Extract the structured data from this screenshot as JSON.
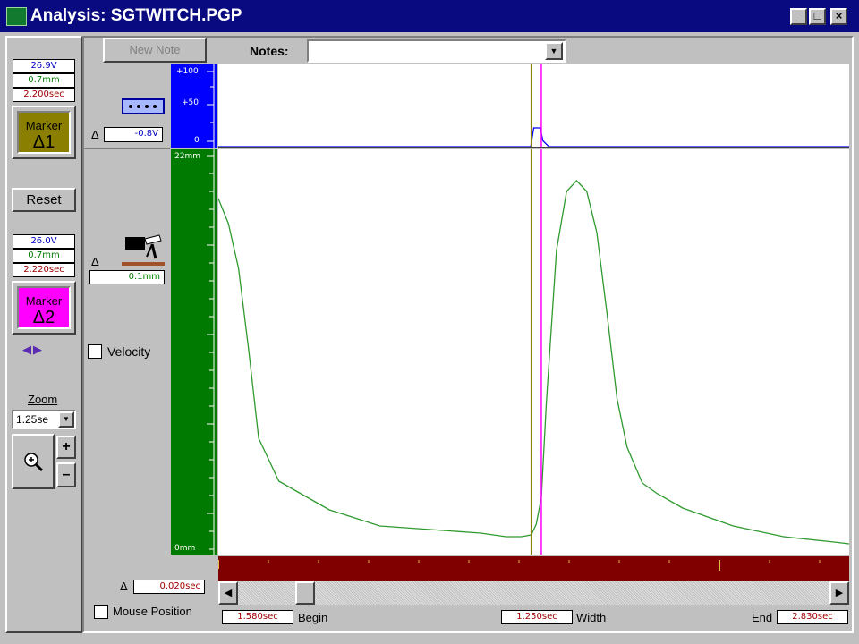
{
  "window": {
    "title": "Analysis: SGTWITCH.PGP",
    "buttons": {
      "minimize": "_",
      "maximize": "□",
      "close": "×"
    }
  },
  "marker1": {
    "voltage": "26.9V",
    "distance": "0.7mm",
    "time": "2.200sec",
    "label": "Marker",
    "symbol": "Δ1",
    "color": "#8a7f00"
  },
  "reset_label": "Reset",
  "marker2": {
    "voltage": "26.0V",
    "distance": "0.7mm",
    "time": "2.220sec",
    "label": "Marker",
    "symbol": "Δ2",
    "color": "#ff00ff"
  },
  "arrows": {
    "left": "◀",
    "right": "▶"
  },
  "zoom": {
    "label": "Zoom",
    "value": "1.25se",
    "plus": "+",
    "minus": "–"
  },
  "toolbar": {
    "new_note": "New Note",
    "notes_label": "Notes:",
    "notes_value": ""
  },
  "stimulus": {
    "delta_symbol": "Δ",
    "delta_value": "-0.8V",
    "scale": {
      "top": "+100",
      "mid": "+50",
      "bottom": "0"
    },
    "color": "#0000ff"
  },
  "force": {
    "delta_symbol": "Δ",
    "delta_value": "0.1mm",
    "scale": {
      "top": "22mm",
      "bottom": "0mm"
    },
    "color": "#007a00",
    "velocity_label": "Velocity"
  },
  "bottom": {
    "delta_symbol": "Δ",
    "delta_value": "0.020sec",
    "mouse_position_label": "Mouse Position",
    "begin_value": "1.580sec",
    "begin_label": "Begin",
    "width_value": "1.250sec",
    "width_label": "Width",
    "end_label": "End",
    "end_value": "2.830sec"
  },
  "chart_data": {
    "type": "line",
    "x_range": [
      1.58,
      2.83
    ],
    "marker_times": [
      2.2,
      2.22
    ],
    "series": [
      {
        "color": "#2f9a2f",
        "ylim": [
          0,
          22
        ],
        "x": [
          1.58,
          1.6,
          1.62,
          1.64,
          1.66,
          1.7,
          1.75,
          1.8,
          1.9,
          2.0,
          2.1,
          2.15,
          2.18,
          2.2,
          2.21,
          2.22,
          2.23,
          2.25,
          2.27,
          2.29,
          2.31,
          2.33,
          2.35,
          2.37,
          2.39,
          2.42,
          2.45,
          2.5,
          2.6,
          2.7,
          2.8,
          2.83
        ],
        "y": [
          19.4,
          18.0,
          15.5,
          11.0,
          6.0,
          3.6,
          2.8,
          2.0,
          1.1,
          0.9,
          0.7,
          0.5,
          0.5,
          0.6,
          1.2,
          2.7,
          8.0,
          16.5,
          19.8,
          20.4,
          19.8,
          17.5,
          13.0,
          8.2,
          5.5,
          3.5,
          2.9,
          2.1,
          1.1,
          0.5,
          0.2,
          0.1
        ]
      },
      {
        "color": "#0000ff",
        "ylim": [
          0,
          100
        ],
        "x": [
          1.58,
          2.199,
          2.205,
          2.212,
          2.218,
          2.223,
          2.235,
          2.83
        ],
        "y": [
          0,
          0,
          25,
          25,
          25,
          8,
          0,
          0
        ]
      }
    ]
  }
}
